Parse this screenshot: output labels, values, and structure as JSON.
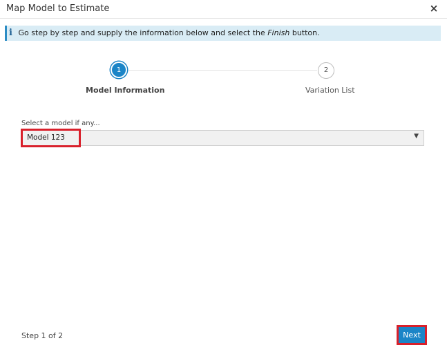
{
  "dialog": {
    "title": "Map Model to Estimate",
    "close_icon": "×"
  },
  "info": {
    "icon": "i",
    "text_before": "Go step by step and supply the information below and select the ",
    "text_emphasis": "Finish",
    "text_after": " button."
  },
  "stepper": {
    "steps": [
      {
        "number": "1",
        "label": "Model Information",
        "state": "active"
      },
      {
        "number": "2",
        "label": "Variation List",
        "state": "inactive"
      }
    ]
  },
  "model_field": {
    "label": "Select a model if any...",
    "value": "Model 123",
    "arrow": "▼"
  },
  "footer": {
    "step_text": "Step 1 of 2",
    "next_label": "Next"
  },
  "colors": {
    "accent": "#1b85c7",
    "highlight": "#d9202b",
    "info_bg": "#d9ecf5"
  }
}
